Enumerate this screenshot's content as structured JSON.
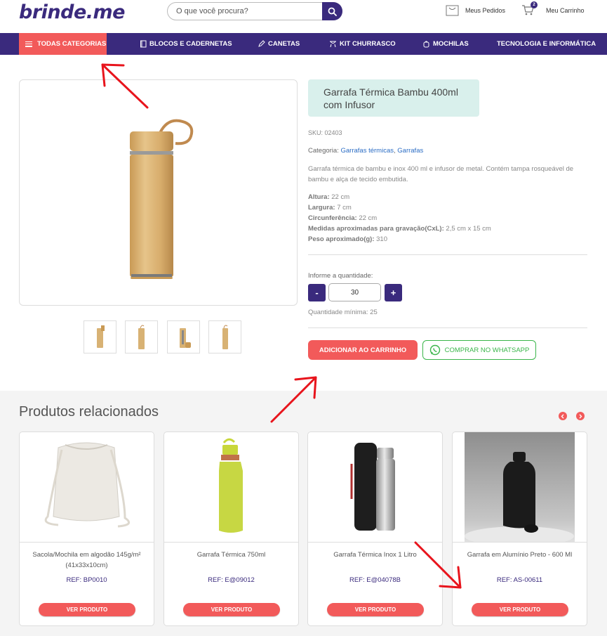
{
  "header": {
    "logo": "brinde.me",
    "search_placeholder": "O que você procura?",
    "orders_label": "Meus Pedidos",
    "cart_label": "Meu Carrinho",
    "cart_count": "2"
  },
  "nav": {
    "all_categories": "TODAS CATEGORIAS",
    "items": [
      {
        "label": "BLOCOS E CADERNETAS",
        "icon": "notebook-icon"
      },
      {
        "label": "CANETAS",
        "icon": "pen-icon"
      },
      {
        "label": "KIT CHURRASCO",
        "icon": "grill-icon"
      },
      {
        "label": "MOCHILAS",
        "icon": "backpack-icon"
      },
      {
        "label": "TECNOLOGIA E INFORMÁTICA",
        "icon": ""
      }
    ]
  },
  "product": {
    "title": "Garrafa Térmica Bambu 400ml com Infusor",
    "sku": "SKU: 02403",
    "category_prefix": "Categoria:",
    "category_1": "Garrafas térmicas",
    "category_sep": ",",
    "category_2": "Garrafas",
    "description": "Garrafa térmica de bambu e inox 400 ml e infusor de metal. Contém tampa rosqueável de bambu e alça de tecido embutida.",
    "specs": [
      {
        "label": "Altura:",
        "value": "22 cm"
      },
      {
        "label": "Largura:",
        "value": "7 cm"
      },
      {
        "label": "Circunferência:",
        "value": "22 cm"
      },
      {
        "label": "Medidas aproximadas para gravação(CxL):",
        "value": "2,5 cm x 15 cm"
      },
      {
        "label": "Peso aproximado(g):",
        "value": "310"
      }
    ],
    "qty_label": "Informe a quantidade:",
    "qty_minus": "-",
    "qty_value": "30",
    "qty_plus": "+",
    "min_qty": "Quantidade mínima: 25",
    "add_to_cart": "ADICIONAR AO CARRINHO",
    "whatsapp": "COMPRAR NO WHATSAPP"
  },
  "related": {
    "title": "Produtos relacionados",
    "products": [
      {
        "name": "Sacola/Mochila em algodão 145g/m² (41x33x10cm)",
        "ref": "REF: BP0010",
        "button": "VER PRODUTO"
      },
      {
        "name": "Garrafa Térmica 750ml",
        "ref": "REF: E@09012",
        "button": "VER PRODUTO"
      },
      {
        "name": "Garrafa Térmica Inox 1 Litro",
        "ref": "REF: E@04078B",
        "button": "VER PRODUTO"
      },
      {
        "name": "Garrafa em Alumínio Preto - 600 Ml",
        "ref": "REF: AS-00611",
        "button": "VER PRODUTO"
      }
    ]
  },
  "colors": {
    "brand_purple": "#3a2a7d",
    "accent_red": "#f25a5a",
    "whatsapp_green": "#3ab54a",
    "title_bg": "#d9f0ec"
  }
}
